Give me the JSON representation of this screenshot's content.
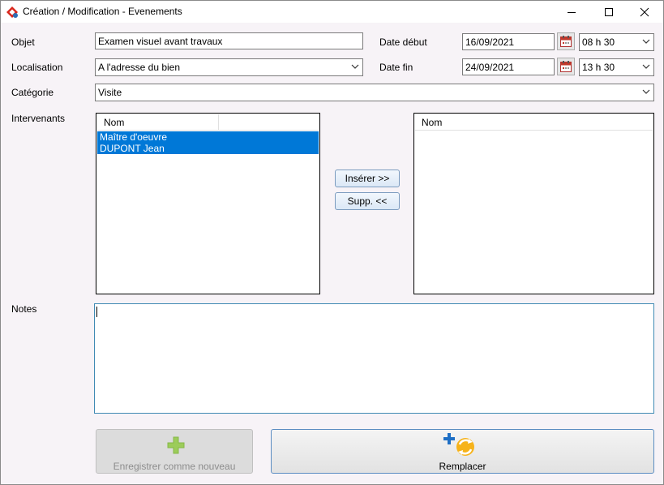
{
  "window": {
    "title": "Création / Modification - Evenements",
    "icons": {
      "app": "app-logo-icon",
      "minimize": "minimize-icon",
      "maximize": "maximize-icon",
      "close": "close-icon"
    }
  },
  "form": {
    "objet": {
      "label": "Objet",
      "value": "Examen visuel avant travaux"
    },
    "localisation": {
      "label": "Localisation",
      "value": "A l'adresse du bien"
    },
    "categorie": {
      "label": "Catégorie",
      "value": "Visite"
    },
    "date_debut": {
      "label": "Date début",
      "date": "16/09/2021",
      "time": "08 h 30"
    },
    "date_fin": {
      "label": "Date fin",
      "date": "24/09/2021",
      "time": "13 h 30"
    },
    "intervenants_label": "Intervenants",
    "notes_label": "Notes"
  },
  "lists": {
    "available": {
      "column": "Nom",
      "rows": [
        "Maître d'oeuvre",
        "DUPONT Jean"
      ]
    },
    "selected": {
      "column": "Nom",
      "rows": []
    }
  },
  "buttons": {
    "inserer": "Insérer >>",
    "supp": "Supp. <<",
    "enregistrer": "Enregistrer comme nouveau",
    "remplacer": "Remplacer"
  },
  "colors": {
    "selection": "#0078d7",
    "window_bg": "#f7f3f7",
    "notes_border": "#3f8ab3",
    "plus_green": "#8cc63f"
  }
}
